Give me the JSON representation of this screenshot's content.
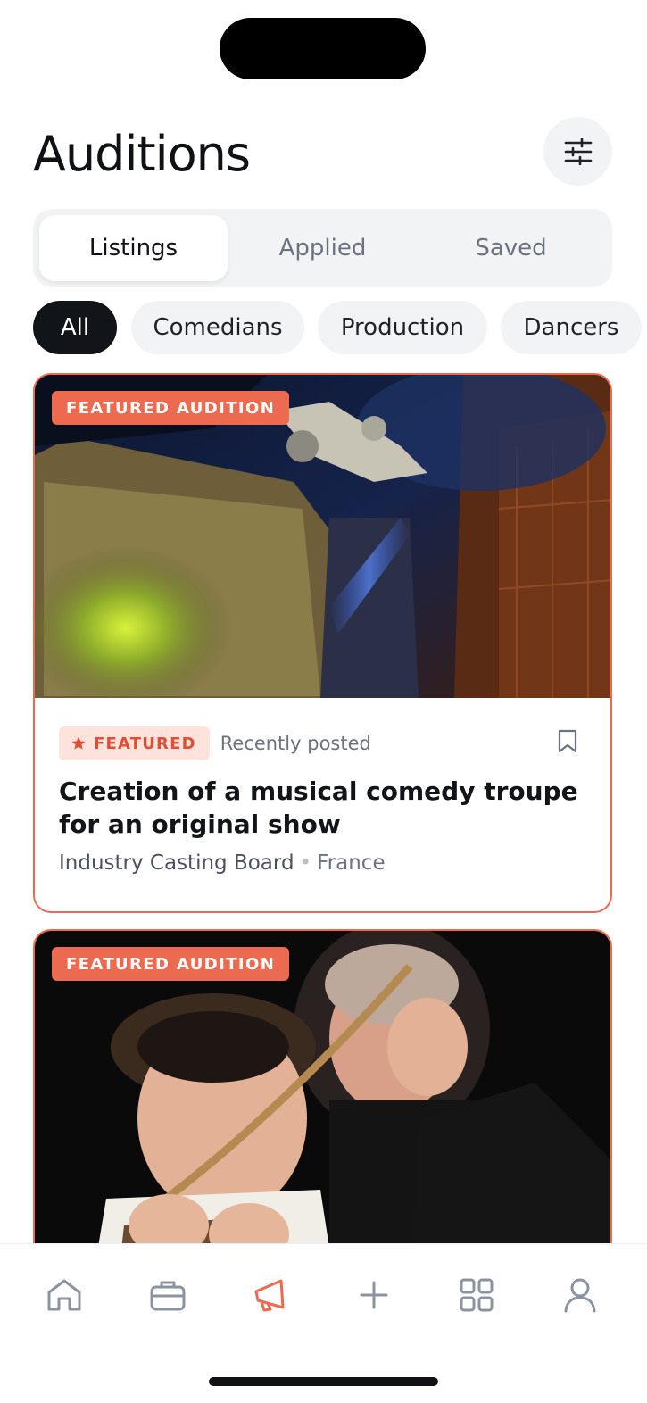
{
  "header": {
    "title": "Auditions",
    "filter_icon": "sliders-icon"
  },
  "segments": [
    {
      "label": "Listings",
      "active": true
    },
    {
      "label": "Applied",
      "active": false
    },
    {
      "label": "Saved",
      "active": false
    }
  ],
  "chips": [
    {
      "label": "All",
      "active": true
    },
    {
      "label": "Comedians",
      "active": false
    },
    {
      "label": "Production",
      "active": false
    },
    {
      "label": "Dancers",
      "active": false
    }
  ],
  "cards": [
    {
      "image_badge": "FEATURED AUDITION",
      "image_desc_icon": "theater-stage-image",
      "featured_label": "FEATURED",
      "posted": "Recently posted",
      "title": "Creation of a musical comedy troupe for an original show",
      "organization": "Industry Casting Board",
      "separator": "•",
      "location": "France"
    },
    {
      "image_badge": "FEATURED AUDITION",
      "image_desc_icon": "actors-performance-image"
    }
  ],
  "tabbar": {
    "items": [
      "home-icon",
      "briefcase-icon",
      "megaphone-icon",
      "plus-icon",
      "grid-icon",
      "profile-icon"
    ],
    "active_index": 2
  },
  "colors": {
    "accent": "#ec6a4f",
    "accent_soft": "#fde3dc",
    "text": "#111418",
    "muted": "#6b7280",
    "chip_bg": "#f2f3f5"
  }
}
